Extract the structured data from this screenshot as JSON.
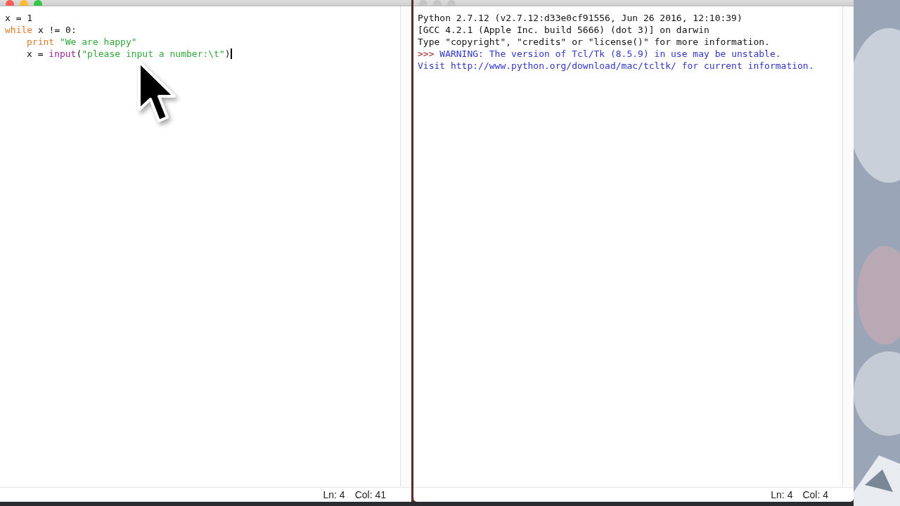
{
  "editor": {
    "lines": [
      {
        "caret": false,
        "tokens": [
          {
            "kind": "plain",
            "text": "x = 1"
          }
        ]
      },
      {
        "caret": false,
        "tokens": [
          {
            "kind": "keyword",
            "text": "while"
          },
          {
            "kind": "plain",
            "text": " x != 0:"
          }
        ],
        "children": [
          {
            "caret": false,
            "tokens": [
              {
                "kind": "keyword",
                "text": "print"
              },
              {
                "kind": "string",
                "text": " \"We are happy\""
              }
            ]
          },
          {
            "caret": true,
            "tokens": [
              {
                "kind": "plain",
                "text": "x = "
              },
              {
                "kind": "builtin",
                "text": "input"
              },
              {
                "kind": "plain",
                "text": "("
              },
              {
                "kind": "string",
                "text": "\"please input a number:\\t\""
              },
              {
                "kind": "plain",
                "text": ")"
              }
            ]
          }
        ]
      }
    ],
    "status": {
      "line": "Ln: 4",
      "column": "Col: 41"
    }
  },
  "shell": {
    "lines": [
      {
        "tokens": [
          {
            "kind": "output",
            "text": "Python 2.7.12 (v2.7.12:d33e0cf91556, Jun 26 2016, 12:10:39)"
          }
        ]
      },
      {
        "tokens": [
          {
            "kind": "output",
            "text": "[GCC 4.2.1 (Apple Inc. build 5666) (dot 3)] on darwin"
          }
        ]
      },
      {
        "tokens": [
          {
            "kind": "output",
            "text": "Type \"copyright\", \"credits\" or \"license()\" for more information."
          }
        ]
      },
      {
        "tokens": [
          {
            "kind": "prompt",
            "text": ">>> "
          },
          {
            "kind": "warning",
            "text": "WARNING: The version of Tcl/Tk (8.5.9) in use may be unstable."
          }
        ]
      },
      {
        "tokens": [
          {
            "kind": "warning",
            "text": "Visit http://www.python.org/download/mac/tcltk/ for current information."
          }
        ]
      }
    ],
    "status": {
      "line": "Ln: 4",
      "column": "Col: 4"
    }
  }
}
